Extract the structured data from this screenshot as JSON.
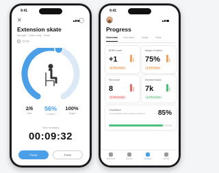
{
  "exercise": {
    "status_time": "9:41",
    "title": "Extension skate",
    "subtitle": "Strength · Lower body · Skate",
    "duration": "10 min",
    "stats": [
      {
        "value": "2/6",
        "label": "Sets"
      },
      {
        "value": "56%",
        "label": "Current"
      },
      {
        "value": "100%",
        "label": "Target"
      }
    ],
    "progress_fraction": 0.56,
    "time_remaining_label": "Time remaining",
    "timer": "00:09:32",
    "pause_label": "Pause",
    "finish_label": "Finish",
    "colors": {
      "accent": "#4a9fe6",
      "track": "#dbe9f7"
    }
  },
  "progress": {
    "status_time": "9:41",
    "title": "Progress",
    "tabs": [
      "Overview",
      "Exercises",
      "Steps",
      "Stats"
    ],
    "cards": [
      {
        "title": "BORG score",
        "value": "+1",
        "delta": "23% increase",
        "tone": "orange",
        "symbol": "▲"
      },
      {
        "title": "Range of motion",
        "value": "75%",
        "delta": "4% increase",
        "tone": "orange",
        "symbol": "▲"
      },
      {
        "title": "Pain score",
        "value": "8",
        "delta": "12% increase",
        "tone": "red",
        "symbol": "▼"
      },
      {
        "title": "Exercise blocks",
        "value": "7k",
        "delta": "12% increase",
        "tone": "green",
        "symbol": "▲"
      }
    ],
    "compliance": {
      "title": "Compliance",
      "description": "Your participation has increased, well done",
      "value": "85%",
      "fraction": 0.85
    },
    "nav": [
      {
        "label": "Dashboard",
        "icon": "home-icon"
      },
      {
        "label": "Exercise",
        "icon": "dumbbell-icon"
      },
      {
        "label": "Progress",
        "icon": "chart-icon"
      },
      {
        "label": "Settings",
        "icon": "gear-icon"
      }
    ]
  }
}
